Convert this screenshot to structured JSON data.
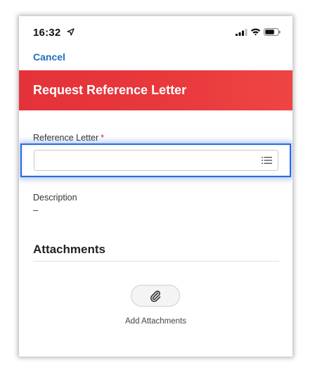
{
  "status_bar": {
    "time": "16:32",
    "icons": [
      "location-arrow-icon",
      "signal-icon",
      "wifi-icon",
      "battery-icon"
    ]
  },
  "nav": {
    "cancel_label": "Cancel"
  },
  "header": {
    "title": "Request Reference Letter",
    "color": "#e8393c"
  },
  "form": {
    "reference_letter": {
      "label": "Reference Letter",
      "required_mark": "*",
      "value": "",
      "icon": "list-icon"
    },
    "description": {
      "label": "Description",
      "value": "–"
    }
  },
  "attachments": {
    "title": "Attachments",
    "button_icon": "paperclip-icon",
    "add_label": "Add Attachments"
  },
  "colors": {
    "accent_link": "#1f6fbf",
    "focus_ring": "#2d6ae0",
    "required": "#d63333"
  }
}
